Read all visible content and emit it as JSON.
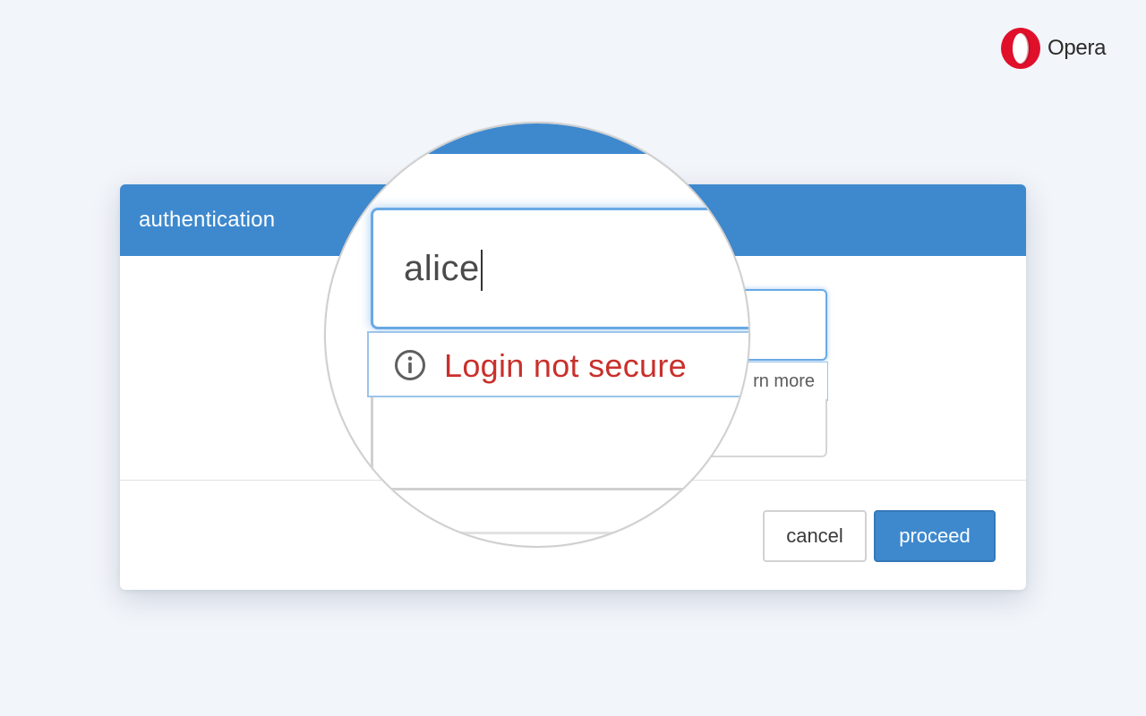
{
  "brand": {
    "name": "Opera",
    "logo_icon": "opera-logo-icon",
    "colors": {
      "logo": "#e0102b",
      "text": "#2b2b2b"
    }
  },
  "dialog": {
    "title": "authentication",
    "username_value": "alice",
    "warning_text": "Login not secure",
    "learn_more_partial": "rn more",
    "buttons": {
      "cancel_label": "cancel",
      "proceed_label": "proceed"
    },
    "colors": {
      "header": "#3e89ce",
      "warning": "#c9302c",
      "focus_border": "#6aa9e4"
    }
  },
  "magnifier": {
    "icon": "info-icon"
  }
}
